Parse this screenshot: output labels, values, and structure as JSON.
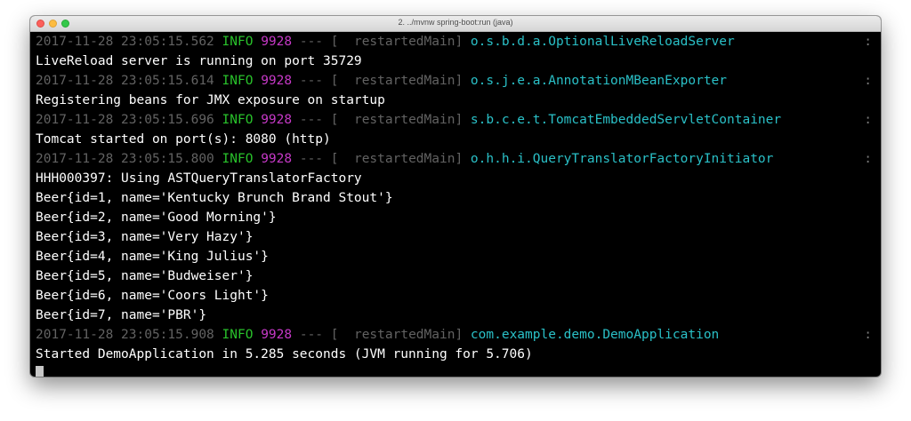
{
  "window": {
    "title": "2. ../mvnw spring-boot:run (java)"
  },
  "log_lines": [
    {
      "kind": "log",
      "timestamp": "2017-11-28 23:05:15.562",
      "level": "INFO",
      "pid": "9928",
      "separator": "---",
      "thread": "[  restartedMain]",
      "logger": "o.s.b.d.a.OptionalLiveReloadServer",
      "colon": ":"
    },
    {
      "kind": "text",
      "text": "LiveReload server is running on port 35729"
    },
    {
      "kind": "log",
      "timestamp": "2017-11-28 23:05:15.614",
      "level": "INFO",
      "pid": "9928",
      "separator": "---",
      "thread": "[  restartedMain]",
      "logger": "o.s.j.e.a.AnnotationMBeanExporter",
      "colon": ":"
    },
    {
      "kind": "text",
      "text": "Registering beans for JMX exposure on startup"
    },
    {
      "kind": "log",
      "timestamp": "2017-11-28 23:05:15.696",
      "level": "INFO",
      "pid": "9928",
      "separator": "---",
      "thread": "[  restartedMain]",
      "logger": "s.b.c.e.t.TomcatEmbeddedServletContainer",
      "colon": ":"
    },
    {
      "kind": "text",
      "text": "Tomcat started on port(s): 8080 (http)"
    },
    {
      "kind": "log",
      "timestamp": "2017-11-28 23:05:15.800",
      "level": "INFO",
      "pid": "9928",
      "separator": "---",
      "thread": "[  restartedMain]",
      "logger": "o.h.h.i.QueryTranslatorFactoryInitiator",
      "colon": ":"
    },
    {
      "kind": "text",
      "text": "HHH000397: Using ASTQueryTranslatorFactory"
    },
    {
      "kind": "text",
      "text": "Beer{id=1, name='Kentucky Brunch Brand Stout'}"
    },
    {
      "kind": "text",
      "text": "Beer{id=2, name='Good Morning'}"
    },
    {
      "kind": "text",
      "text": "Beer{id=3, name='Very Hazy'}"
    },
    {
      "kind": "text",
      "text": "Beer{id=4, name='King Julius'}"
    },
    {
      "kind": "text",
      "text": "Beer{id=5, name='Budweiser'}"
    },
    {
      "kind": "text",
      "text": "Beer{id=6, name='Coors Light'}"
    },
    {
      "kind": "text",
      "text": "Beer{id=7, name='PBR'}"
    },
    {
      "kind": "log",
      "timestamp": "2017-11-28 23:05:15.908",
      "level": "INFO",
      "pid": "9928",
      "separator": "---",
      "thread": "[  restartedMain]",
      "logger": "com.example.demo.DemoApplication",
      "colon": ":"
    },
    {
      "kind": "text",
      "text": "Started DemoApplication in 5.285 seconds (JVM running for 5.706)"
    }
  ],
  "colors": {
    "timestamp": "#626262",
    "level_info": "#29c22b",
    "pid": "#c639c7",
    "logger": "#2ac0c7",
    "text": "#ffffff",
    "background": "#000000"
  }
}
